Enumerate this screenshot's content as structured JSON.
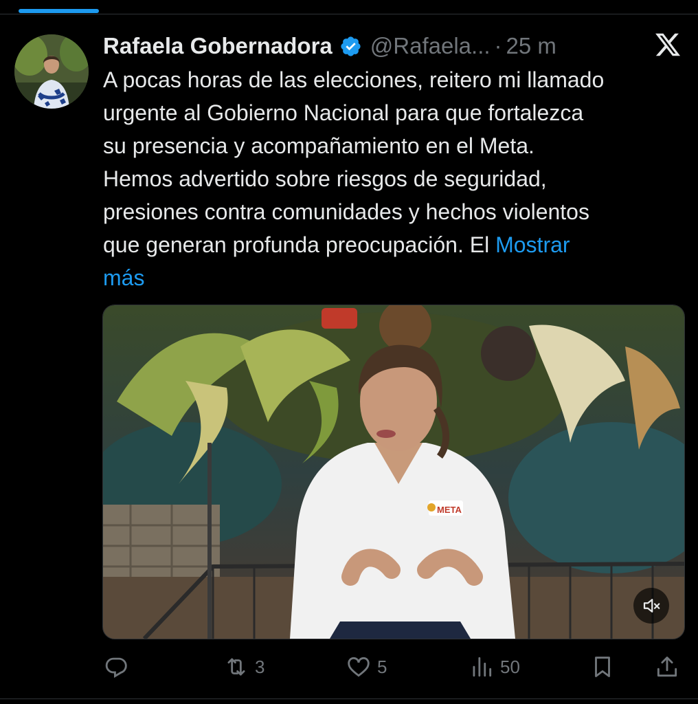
{
  "tweet": {
    "author_name": "Rafaela Gobernadora",
    "handle": "@Rafaela...",
    "separator": "·",
    "time": "25 m",
    "text_lines": [
      "A pocas horas de las elecciones, reitero mi llamado",
      "urgente al Gobierno Nacional para que fortalezca",
      "su presencia y acompañamiento en el Meta.",
      "Hemos advertido sobre riesgos de seguridad,",
      "presiones contra comunidades y hechos violentos",
      "que generan profunda preocupación. El "
    ],
    "show_more": "Mostrar",
    "show_more_2": "más",
    "media": {
      "type": "video",
      "shirt_logo_text": "META",
      "muted": true
    },
    "actions": {
      "replies": "",
      "reposts": "3",
      "likes": "5",
      "views": "50"
    }
  },
  "icons": {
    "brand": "x-logo-icon",
    "verified": "verified-badge-icon",
    "reply": "reply-icon",
    "repost": "repost-icon",
    "like": "heart-icon",
    "views": "views-icon",
    "bookmark": "bookmark-icon",
    "share": "share-icon",
    "mute": "speaker-muted-icon"
  },
  "colors": {
    "background": "#000000",
    "text": "#e7e9ea",
    "secondary": "#71767b",
    "accent": "#1d9bf0"
  }
}
